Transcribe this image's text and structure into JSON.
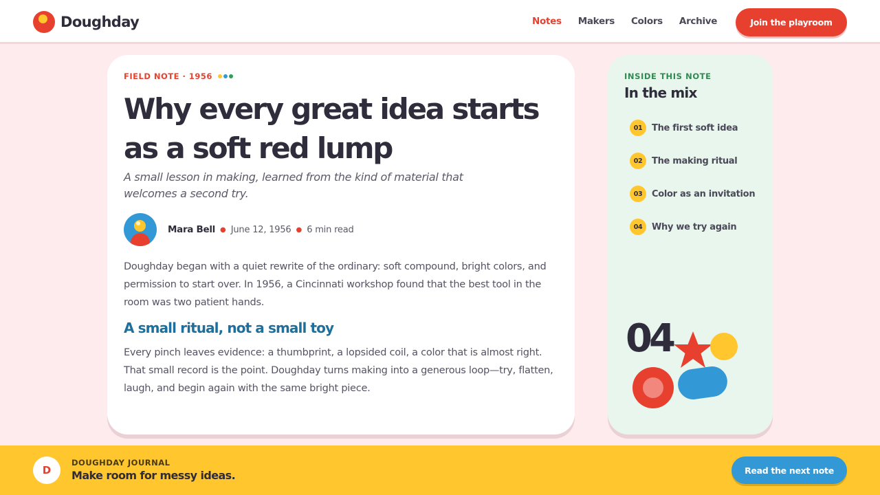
{
  "header": {
    "brand": "Doughday",
    "nav": [
      {
        "label": "Notes",
        "active": true
      },
      {
        "label": "Makers",
        "active": false
      },
      {
        "label": "Colors",
        "active": false
      },
      {
        "label": "Archive",
        "active": false
      }
    ],
    "cta": "Join the playroom"
  },
  "article": {
    "kicker": "FIELD NOTE · 1956",
    "title": "Why every great idea starts as a soft red lump",
    "dek": "A small lesson in making, learned from the kind of material that welcomes a second try.",
    "author": "Mara Bell",
    "date": "June 12, 1956",
    "read_time": "6 min read",
    "para1": "Doughday began with a quiet rewrite of the ordinary: soft compound, bright colors, and permission to start over. In 1956, a Cincinnati workshop found that the best tool in the room was two patient hands.",
    "subhead": "A small ritual, not a small toy",
    "para2": "Every pinch leaves evidence: a thumbprint, a lopsided coil, a color that is almost right. That small record is the point. Doughday turns making into a generous loop—try, flatten, laugh, and begin again with the same bright piece."
  },
  "sidebar": {
    "kicker": "INSIDE THIS NOTE",
    "title": "In the mix",
    "items": [
      {
        "num": "01",
        "label": "The first soft idea"
      },
      {
        "num": "02",
        "label": "The making ritual"
      },
      {
        "num": "03",
        "label": "Color as an invitation"
      },
      {
        "num": "04",
        "label": "Why we try again"
      }
    ],
    "count": "04"
  },
  "footer": {
    "logo_letter": "D",
    "kicker": "DOUGHDAY JOURNAL",
    "tagline": "Make room for messy ideas.",
    "cta": "Read the next note"
  },
  "colors": {
    "red": "#e8402f",
    "yellow": "#ffc62e",
    "blue": "#3398d6",
    "green": "#2f8a4f",
    "mint": "#e8f6ee",
    "pink": "#fdebee"
  }
}
